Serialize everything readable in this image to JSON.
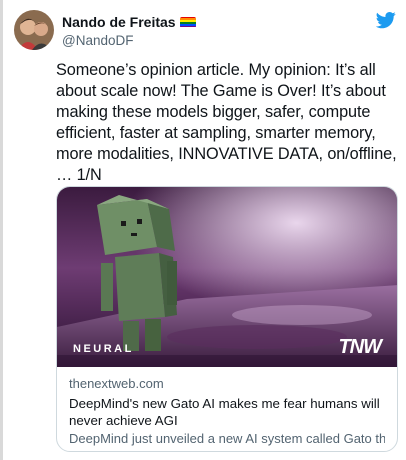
{
  "tweet": {
    "display_name": "Nando de Freitas",
    "handle": "@NandoDF",
    "text": "Someone’s opinion article. My opinion: It’s all about scale now! The Game is Over! It’s about making these models bigger, safer, compute efficient, faster at sampling, smarter memory, more modalities, INNOVATIVE DATA, on/offline, … 1/N",
    "badge_icon": "rainbow-flag-icon",
    "brand_icon": "twitter-bird-icon",
    "brand_color": "#1d9bf0"
  },
  "card": {
    "image_logo_left": "NEURAL",
    "image_logo_right": "TNW",
    "domain": "thenextweb.com",
    "title": "DeepMind's new Gato AI makes me fear humans will never achieve AGI",
    "description": "DeepMind just unveiled a new AI system called Gato th..."
  }
}
